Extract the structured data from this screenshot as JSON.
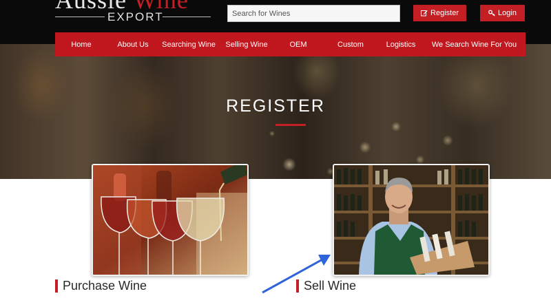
{
  "header": {
    "logo": {
      "top_text": "Aussie",
      "accent_text": "Wine",
      "bottom_text": "EXPORT"
    },
    "search": {
      "placeholder": "Search for Wines",
      "value": ""
    },
    "register_label": "Register",
    "login_label": "Login",
    "register_icon": "edit-icon",
    "login_icon": "key-icon"
  },
  "nav": {
    "items": [
      {
        "label": "Home"
      },
      {
        "label": "About Us"
      },
      {
        "label": "Searching Wine"
      },
      {
        "label": "Selling Wine"
      },
      {
        "label": "OEM"
      },
      {
        "label": "Custom"
      },
      {
        "label": "Logistics"
      },
      {
        "label": "We Search Wine For You"
      }
    ]
  },
  "hero": {
    "title": "REGISTER"
  },
  "cards": [
    {
      "label": "Purchase Wine",
      "image": "wine-glasses-pour-image"
    },
    {
      "label": "Sell Wine",
      "image": "wine-seller-image"
    }
  ],
  "annotation": {
    "type": "arrow",
    "color": "#2f63d9"
  },
  "colors": {
    "brand_red": "#c41f24",
    "nav_red": "#c0181e",
    "header_bg": "#0a0a0a"
  }
}
